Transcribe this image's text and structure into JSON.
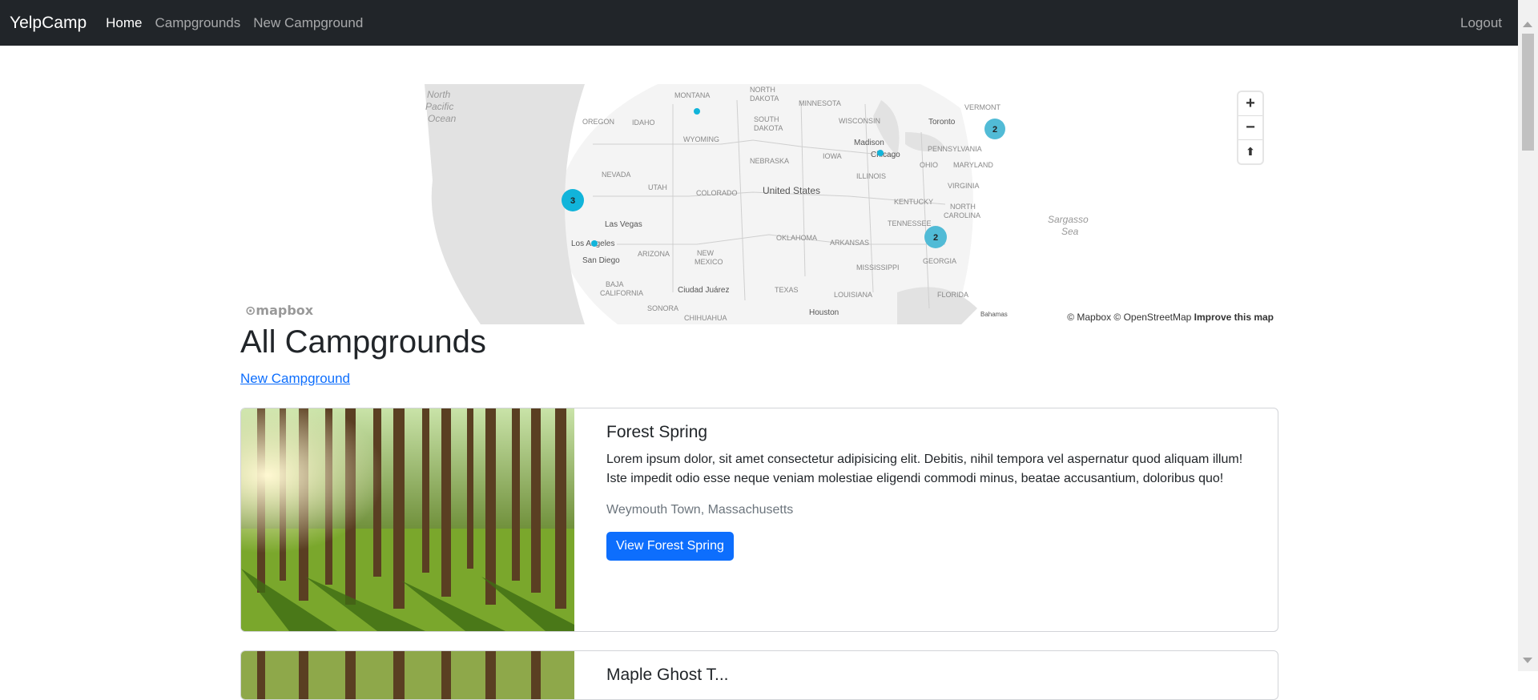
{
  "navbar": {
    "brand": "YelpCamp",
    "links": [
      "Home",
      "Campgrounds",
      "New Campground"
    ],
    "logout": "Logout"
  },
  "map": {
    "labels": {
      "ocean_pacific": [
        "North",
        "Pacific",
        "Ocean"
      ],
      "sargasso": [
        "Sargasso",
        "Sea"
      ],
      "montana": "MONTANA",
      "north_dakota": [
        "NORTH",
        "DAKOTA"
      ],
      "minnesota": "MINNESOTA",
      "oregon": "OREGON",
      "idaho": "IDAHO",
      "wyoming": "WYOMING",
      "south_dakota": [
        "SOUTH",
        "DAKOTA"
      ],
      "wisconsin": "WISCONSIN",
      "vermont": "VERMONT",
      "toronto": "Toronto",
      "madison": "Madison",
      "chicago": "Chicago",
      "pennsylvania": "PENNSYLVANIA",
      "nevada": "NEVADA",
      "nebraska": "NEBRASKA",
      "iowa": "IOWA",
      "ohio": "OHIO",
      "maryland": "MARYLAND",
      "utah": "UTAH",
      "colorado": "COLORADO",
      "illinois": "ILLINOIS",
      "united_states": "United States",
      "virginia": "VIRGINIA",
      "kentucky": "KENTUCKY",
      "north_carolina": [
        "NORTH",
        "CAROLINA"
      ],
      "las_vegas": "Las Vegas",
      "tennessee": "TENNESSEE",
      "arizona": "ARIZONA",
      "oklahoma": "OKLAHOMA",
      "arkansas": "ARKANSAS",
      "los_angeles": "Los Angeles",
      "new_mexico": [
        "NEW",
        "MEXICO"
      ],
      "georgia": "GEORGIA",
      "san_diego": "San Diego",
      "mississippi": "MISSISSIPPI",
      "baja": [
        "BAJA",
        "CALIFORNIA"
      ],
      "ciudad_juarez": "Ciudad Juárez",
      "texas": "TEXAS",
      "louisiana": "LOUISIANA",
      "florida": "FLORIDA",
      "sonora": "SONORA",
      "chihuahua": "CHIHUAHUA",
      "houston": "Houston",
      "bahamas": "Bahamas"
    },
    "clusters": [
      "3",
      "2",
      "2"
    ],
    "controls": {
      "zoom_in": "+",
      "zoom_out": "−",
      "compass": "⬆"
    },
    "logo": "mapbox",
    "attribution": "© Mapbox © OpenStreetMap",
    "improve": "Improve this map"
  },
  "page_title": "All Campgrounds",
  "new_campground_link": "New Campground",
  "campgrounds": [
    {
      "title": "Forest Spring",
      "description": "Lorem ipsum dolor, sit amet consectetur adipisicing elit. Debitis, nihil tempora vel aspernatur quod aliquam illum! Iste impedit odio esse neque veniam molestiae eligendi commodi minus, beatae accusantium, doloribus quo!",
      "location": "Weymouth Town, Massachusetts",
      "button": "View Forest Spring"
    },
    {
      "title": "Maple Ghost T..."
    }
  ],
  "colors": {
    "navbar": "#212529",
    "primary": "#0d6efd",
    "cluster": "#11b4da"
  }
}
